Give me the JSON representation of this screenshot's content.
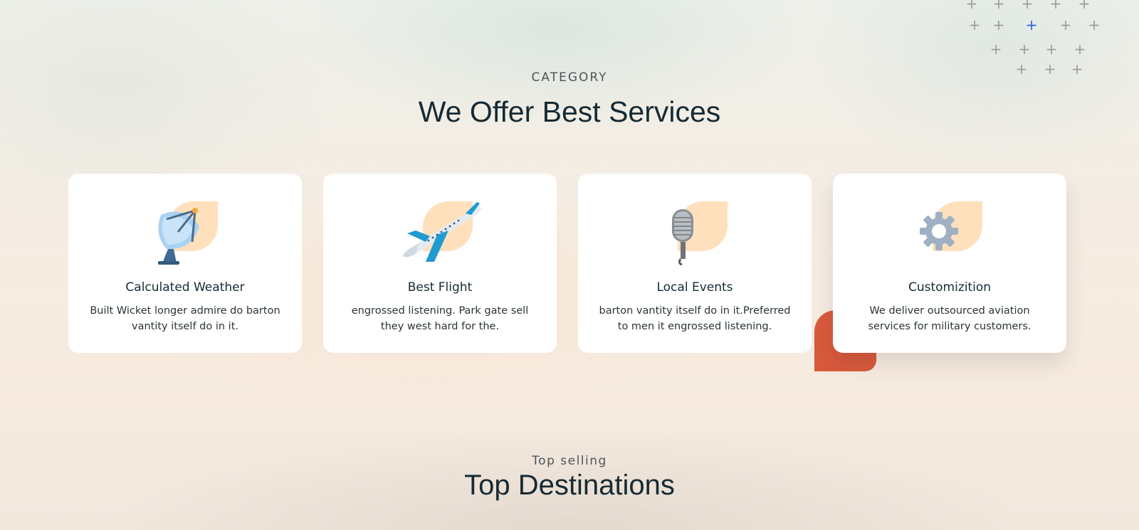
{
  "services_section": {
    "eyebrow": "CATEGORY",
    "heading": "We Offer Best Services",
    "cards": [
      {
        "icon": "satellite-dish-icon",
        "title": "Calculated Weather",
        "text": "Built Wicket longer admire do barton vantity itself do in it."
      },
      {
        "icon": "airplane-icon",
        "title": "Best Flight",
        "text": "engrossed listening. Park gate sell they west hard for the."
      },
      {
        "icon": "microphone-icon",
        "title": "Local Events",
        "text": "barton vantity itself do in it.Preferred to men it engrossed listening."
      },
      {
        "icon": "gear-icon",
        "title": "Customizition",
        "text": "We deliver outsourced aviation services for military customers."
      }
    ]
  },
  "destinations_section": {
    "eyebrow": "Top selling",
    "heading": "Top Destinations"
  },
  "colors": {
    "heading": "#172a33",
    "accent_orange": "#d95a3d",
    "icon_blob": "#ffe0bd",
    "plus_highlight": "#2f5fe0"
  }
}
